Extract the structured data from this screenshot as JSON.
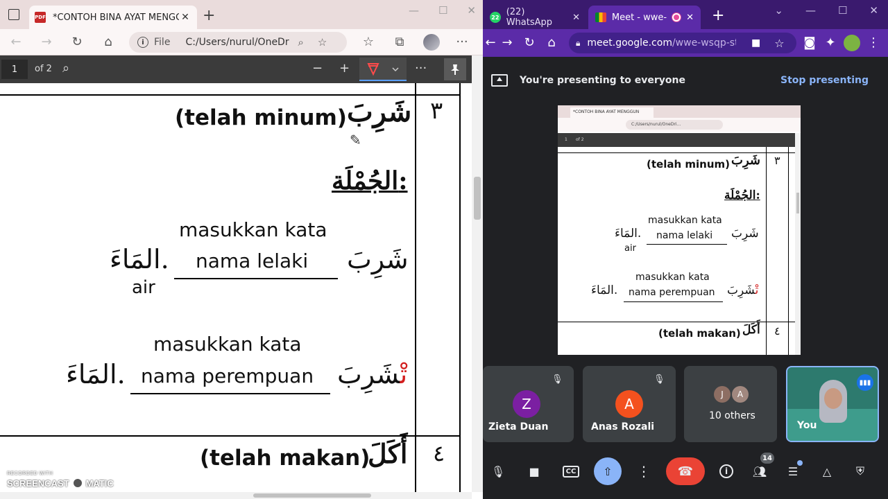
{
  "edge": {
    "tab_title": "*CONTOH BINA AYAT MENGGUNAKAN",
    "address_file": "File",
    "address_url": "C:/Users/nurul/OneDrive/",
    "pdf_page": "1",
    "pdf_of": "of 2"
  },
  "pdf": {
    "num3": "٣",
    "num4": "٤",
    "word_syariba": "شَرِبَ",
    "telah_minum": "(telah minum)",
    "aljumlah": "الجُمْلَة:",
    "masukkan1": "masukkan kata",
    "nama_lelaki": "nama lelaki",
    "syariba_line": "شَرِبَ",
    "almaa": "المَاءَ.",
    "air": "air",
    "masukkan2": "masukkan kata",
    "nama_perempuan": "nama perempuan",
    "syaribat_base": "شَرِبَ",
    "syaribat_suffix": "تْ",
    "almaa2": "المَاءَ.",
    "akala": "أَكَلَ",
    "telah_makan": "(telah makan)"
  },
  "watermark": {
    "line1": "RECORDED WITH",
    "line2a": "SCREENCAST",
    "line2b": "MATIC"
  },
  "chrome": {
    "tab_whatsapp": "(22) WhatsApp",
    "wa_count": "22",
    "tab_meet": "Meet - wwe-wsqp-str",
    "url_host": "meet.google.com",
    "url_path": "/wwe-wsqp-str"
  },
  "meet": {
    "presenting_text": "You're presenting to everyone",
    "stop_presenting": "Stop presenting",
    "tiles": {
      "zieta_initial": "Z",
      "zieta_name": "Zieta Duan",
      "anas_initial": "A",
      "anas_name": "Anas Rozali",
      "others_j": "J",
      "others_a": "A",
      "others_label": "10 others",
      "you_label": "You"
    },
    "people_count": "14",
    "colors": {
      "zieta": "#7b1fa2",
      "anas": "#f4511e",
      "hangup": "#ea4335",
      "present_active": "#8ab4f8"
    }
  },
  "mini": {
    "tab_title": "*CONTOH BINA AYAT MENGGUN",
    "addr": "C:/Users/nurul/OneDri...",
    "page": "1",
    "of": "of 2"
  }
}
